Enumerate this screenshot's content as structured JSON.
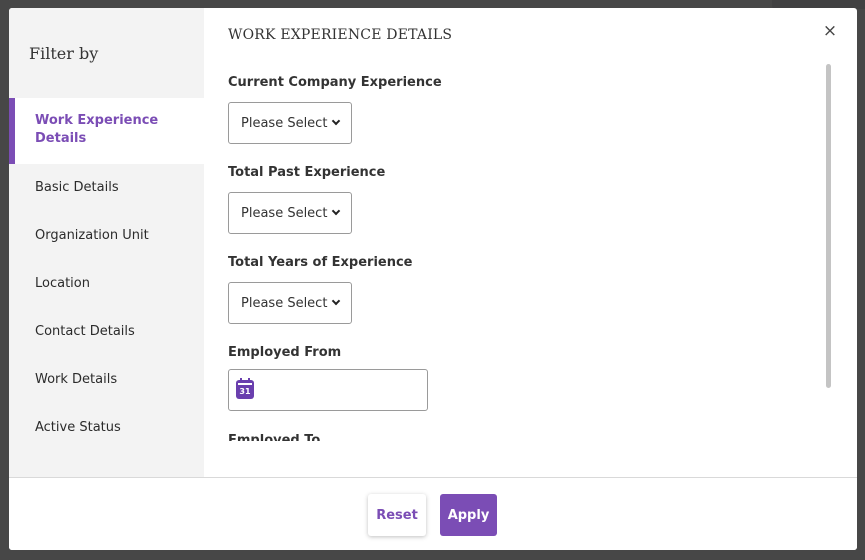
{
  "modal": {
    "filter_title": "Filter by",
    "close_glyph": "×",
    "sidebar": {
      "items": [
        {
          "label": "Work Experience Details",
          "active": true
        },
        {
          "label": "Basic Details",
          "active": false
        },
        {
          "label": "Organization Unit",
          "active": false
        },
        {
          "label": "Location",
          "active": false
        },
        {
          "label": "Contact Details",
          "active": false
        },
        {
          "label": "Work Details",
          "active": false
        },
        {
          "label": "Active Status",
          "active": false
        }
      ]
    },
    "section": {
      "title": "WORK EXPERIENCE DETAILS",
      "fields": [
        {
          "label": "Current Company Experience",
          "value": "Please Select"
        },
        {
          "label": "Total Past Experience",
          "value": "Please Select"
        },
        {
          "label": "Total Years of Experience",
          "value": "Please Select"
        }
      ],
      "employed_from": {
        "label": "Employed From",
        "value": "",
        "calendar_day": "31"
      },
      "employed_to": {
        "label": "Employed To"
      }
    },
    "footer": {
      "reset_label": "Reset",
      "apply_label": "Apply"
    },
    "colors": {
      "accent": "#7b4db5",
      "sidebar_bg": "#f3f3f3",
      "calendar_icon": "#6a3fae"
    }
  }
}
